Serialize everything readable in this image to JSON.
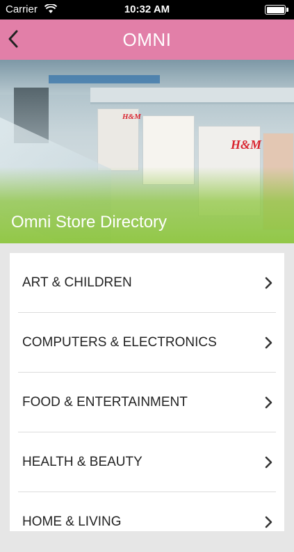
{
  "status_bar": {
    "carrier": "Carrier",
    "time": "10:32 AM",
    "icons": [
      "wifi-icon",
      "battery-icon"
    ]
  },
  "nav": {
    "title": "OMNI",
    "back_icon": "chevron-left-icon",
    "color": "#e27fa8"
  },
  "hero": {
    "title": "Omni Store Directory",
    "store_sign": "H&M",
    "overlay_color": "#8ec63f"
  },
  "categories": [
    {
      "label": "ART & CHILDREN",
      "icon": "chevron-right-icon"
    },
    {
      "label": "COMPUTERS & ELECTRONICS",
      "icon": "chevron-right-icon"
    },
    {
      "label": "FOOD & ENTERTAINMENT",
      "icon": "chevron-right-icon"
    },
    {
      "label": "HEALTH & BEAUTY",
      "icon": "chevron-right-icon"
    },
    {
      "label": "HOME & LIVING",
      "icon": "chevron-right-icon"
    }
  ]
}
